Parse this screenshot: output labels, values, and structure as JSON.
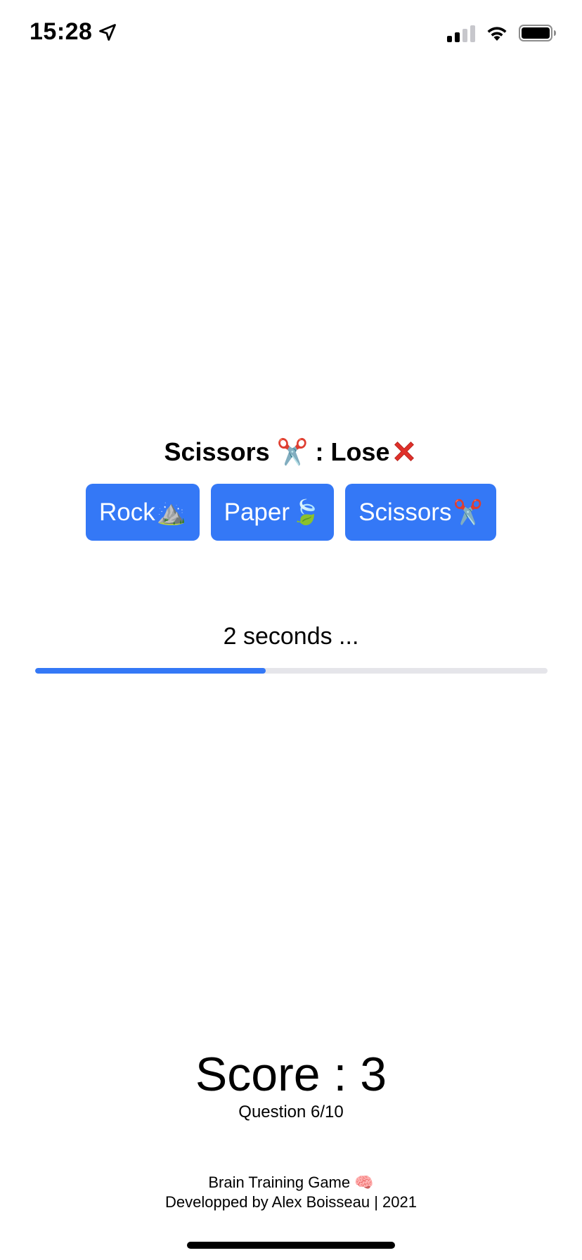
{
  "status_bar": {
    "time": "15:28",
    "location_icon": "location-arrow-icon",
    "signal_icon": "cellular-signal-icon",
    "wifi_icon": "wifi-icon",
    "battery_icon": "battery-icon"
  },
  "prompt": {
    "move_label": "Scissors",
    "move_emoji": "✂️",
    "separator": " : ",
    "goal_label": "Lose",
    "goal_icon": "red-cross-icon"
  },
  "choices": [
    {
      "label": "Rock",
      "emoji": "⛰️"
    },
    {
      "label": "Paper",
      "emoji": "🍃"
    },
    {
      "label": "Scissors",
      "emoji": "✂️"
    }
  ],
  "timer": {
    "text": "2 seconds ...",
    "progress": 0.45,
    "fill_color": "#3478f6",
    "track_color": "#e5e5ea"
  },
  "score": {
    "text": "Score : 3",
    "question_text": "Question 6/10"
  },
  "footer": {
    "line1": "Brain Training Game 🧠",
    "line2": "Developped by Alex Boisseau | 2021"
  },
  "colors": {
    "accent": "#3478f6",
    "lose": "#e0302a"
  }
}
